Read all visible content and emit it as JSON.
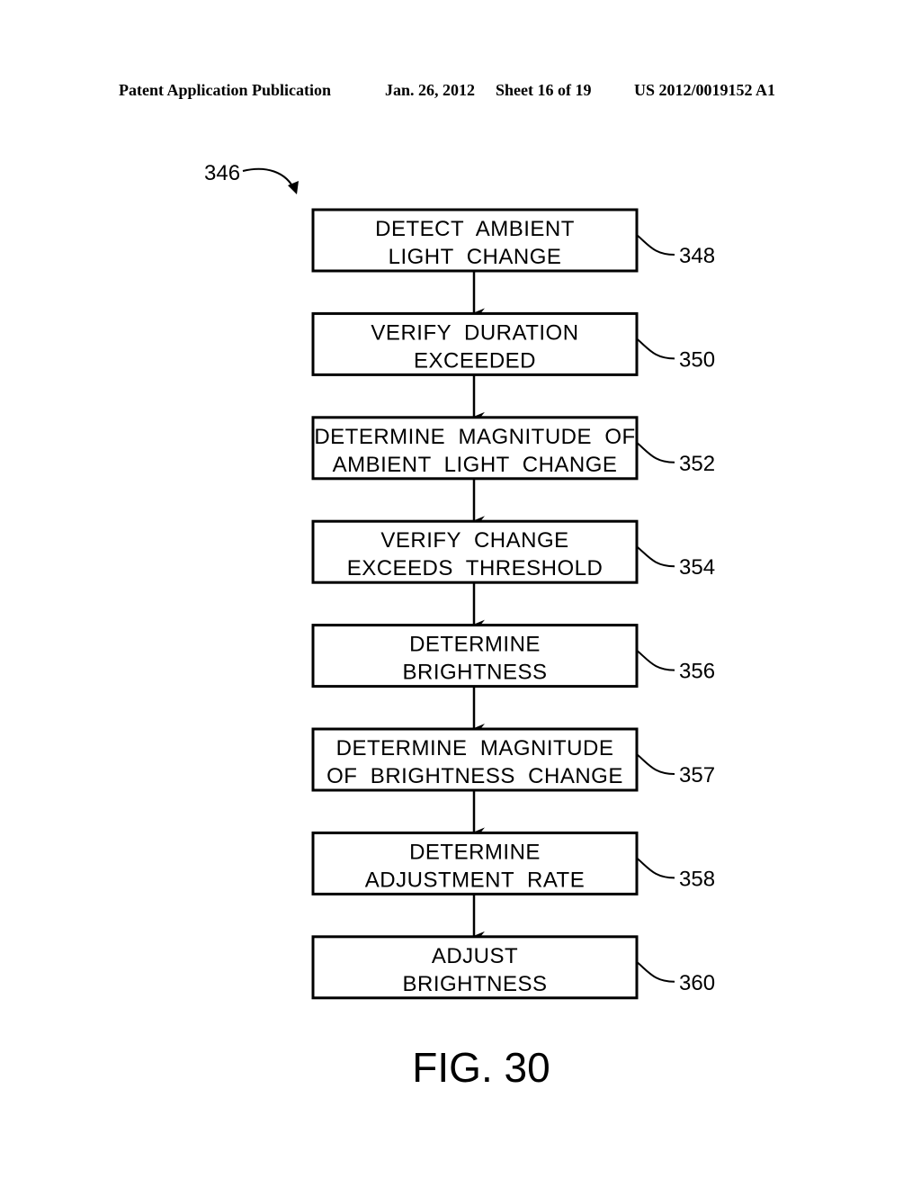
{
  "header": {
    "publication": "Patent Application Publication",
    "date": "Jan. 26, 2012",
    "sheet": "Sheet 16 of 19",
    "number": "US 2012/0019152 A1"
  },
  "diagram": {
    "ref": "346",
    "figure_label": "FIG. 30",
    "steps": [
      {
        "ref": "348",
        "lines": [
          "DETECT  AMBIENT",
          "LIGHT  CHANGE"
        ]
      },
      {
        "ref": "350",
        "lines": [
          "VERIFY  DURATION",
          "EXCEEDED"
        ]
      },
      {
        "ref": "352",
        "lines": [
          "DETERMINE  MAGNITUDE  OF",
          "AMBIENT  LIGHT  CHANGE"
        ]
      },
      {
        "ref": "354",
        "lines": [
          "VERIFY  CHANGE",
          "EXCEEDS  THRESHOLD"
        ]
      },
      {
        "ref": "356",
        "lines": [
          "DETERMINE",
          "BRIGHTNESS"
        ]
      },
      {
        "ref": "357",
        "lines": [
          "DETERMINE  MAGNITUDE",
          "OF  BRIGHTNESS  CHANGE"
        ]
      },
      {
        "ref": "358",
        "lines": [
          "DETERMINE",
          "ADJUSTMENT  RATE"
        ]
      },
      {
        "ref": "360",
        "lines": [
          "ADJUST",
          "BRIGHTNESS"
        ]
      }
    ]
  }
}
